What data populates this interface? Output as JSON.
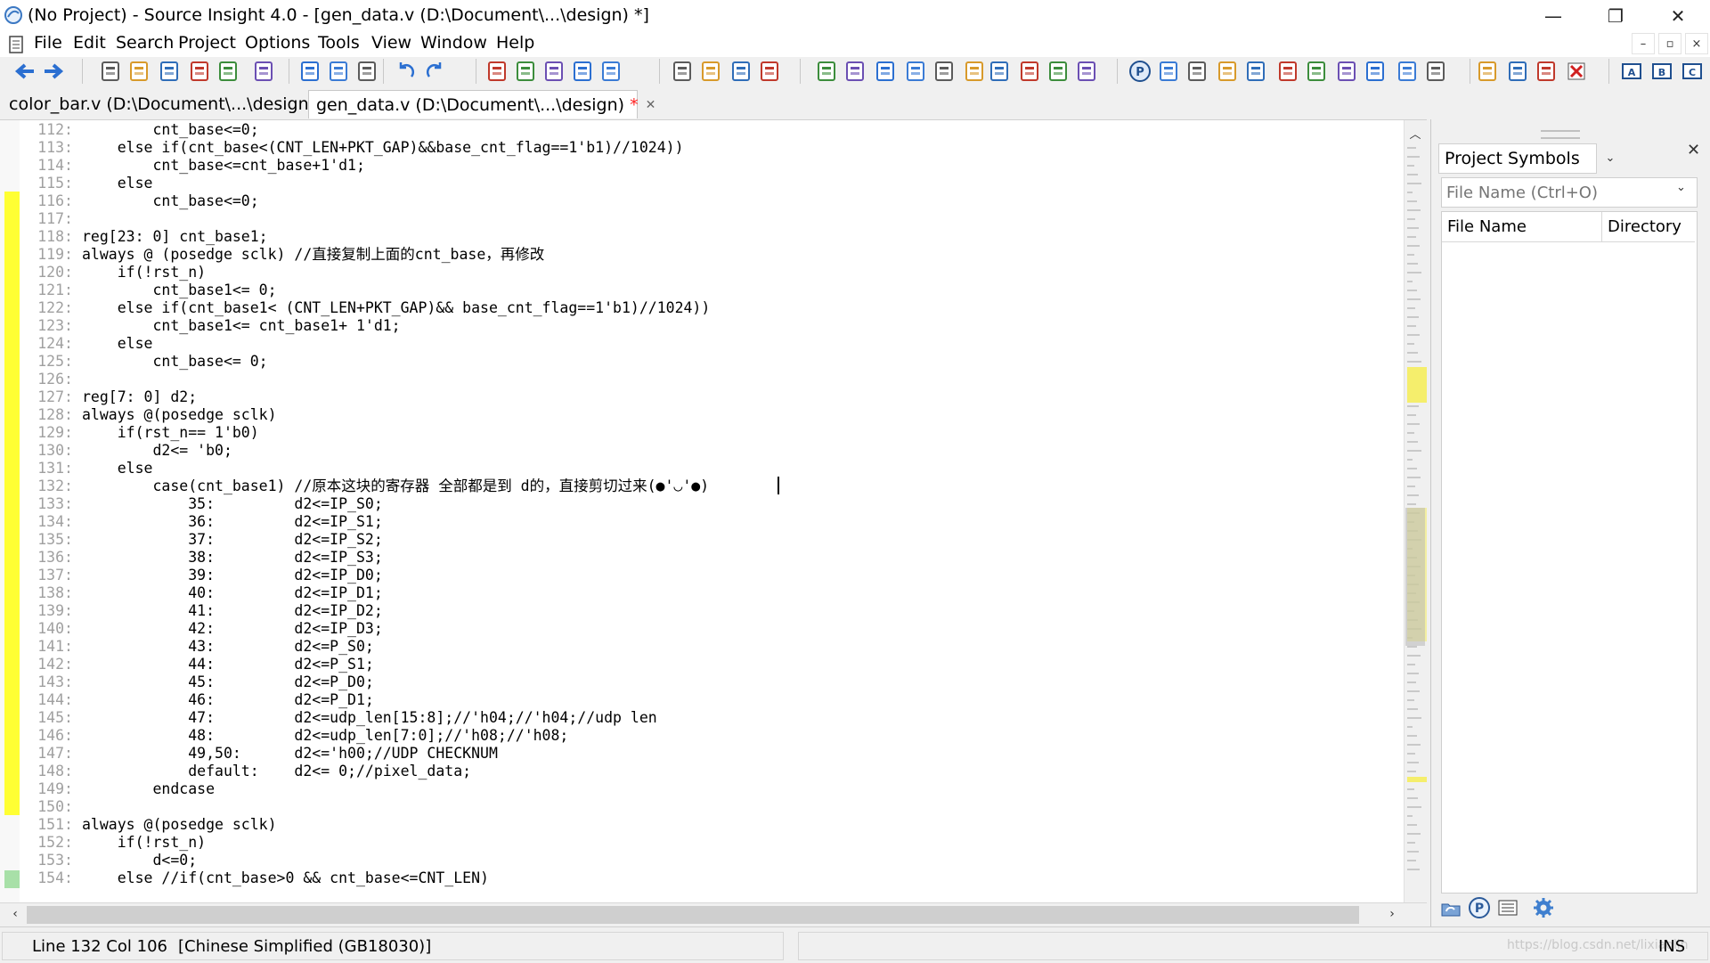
{
  "window": {
    "title": "(No Project) - Source Insight 4.0 - [gen_data.v (D:\\Document\\...\\design) *]",
    "minimize_glyph": "—",
    "restore_glyph": "❐",
    "close_glyph": "✕"
  },
  "menu": {
    "items": [
      "File",
      "Edit",
      "Search",
      "Project",
      "Options",
      "Tools",
      "View",
      "Window",
      "Help"
    ],
    "mdi_minimize": "–",
    "mdi_restore": "▫",
    "mdi_close": "×"
  },
  "toolbar": {
    "icons": [
      "back-icon",
      "forward-icon",
      "new-file-icon",
      "open-file-icon",
      "save-icon",
      "save-as-icon",
      "save-all-icon",
      "print-icon",
      "cut-icon",
      "copy-icon",
      "paste-icon",
      "undo-icon",
      "redo-icon",
      "find-icon",
      "jump-up-icon",
      "jump-down-icon",
      "replace-icon",
      "swap-xy-icon",
      "bookmark-prev-icon",
      "bookmark-next-icon",
      "indent-icon",
      "star-icon",
      "browse-icon",
      "symbol-window-icon",
      "book-icon",
      "function-icon",
      "relation-icon",
      "script-r-icon",
      "grid-icon",
      "horizontal-split-icon",
      "list-icon",
      "windows-icon",
      "project-icon",
      "resize-icon",
      "outline-icon",
      "sync-icon",
      "branch-icon",
      "help-icon",
      "tree-icon",
      "globe-icon",
      "bird-icon",
      "merge-icon",
      "compare-icon",
      "plus-minus-icon",
      "add-row-icon",
      "remove-row-icon",
      "delete-icon",
      "toggle-a-icon",
      "toggle-b-icon",
      "toggle-c-icon"
    ]
  },
  "tabs": [
    {
      "label": "color_bar.v (D:\\Document\\...\\design)",
      "modified": ""
    },
    {
      "label": "gen_data.v (D:\\Document\\...\\design)",
      "modified": "*",
      "close": "✕"
    }
  ],
  "editor": {
    "lines": [
      {
        "n": "112:",
        "t": "        cnt_base<=0;"
      },
      {
        "n": "113:",
        "t": "    else if(cnt_base<(CNT_LEN+PKT_GAP)&&base_cnt_flag==1'b1)//1024))"
      },
      {
        "n": "114:",
        "t": "        cnt_base<=cnt_base+1'd1;"
      },
      {
        "n": "115:",
        "t": "    else"
      },
      {
        "n": "116:",
        "t": "        cnt_base<=0;"
      },
      {
        "n": "117:",
        "t": ""
      },
      {
        "n": "118:",
        "t": "reg[23: 0] cnt_base1;"
      },
      {
        "n": "119:",
        "t": "always @ (posedge sclk) //直接复制上面的cnt_base，再修改"
      },
      {
        "n": "120:",
        "t": "    if(!rst_n)"
      },
      {
        "n": "121:",
        "t": "        cnt_base1<= 0;"
      },
      {
        "n": "122:",
        "t": "    else if(cnt_base1< (CNT_LEN+PKT_GAP)&& base_cnt_flag==1'b1)//1024))"
      },
      {
        "n": "123:",
        "t": "        cnt_base1<= cnt_base1+ 1'd1;"
      },
      {
        "n": "124:",
        "t": "    else"
      },
      {
        "n": "125:",
        "t": "        cnt_base<= 0;"
      },
      {
        "n": "126:",
        "t": ""
      },
      {
        "n": "127:",
        "t": "reg[7: 0] d2;"
      },
      {
        "n": "128:",
        "t": "always @(posedge sclk)"
      },
      {
        "n": "129:",
        "t": "    if(rst_n== 1'b0)"
      },
      {
        "n": "130:",
        "t": "        d2<= 'b0;"
      },
      {
        "n": "131:",
        "t": "    else"
      },
      {
        "n": "132:",
        "t": "        case(cnt_base1) //原本这块的寄存器 全部都是到 d的，直接剪切过来(●'◡'●)"
      },
      {
        "n": "133:",
        "t": "            35:         d2<=IP_S0;"
      },
      {
        "n": "134:",
        "t": "            36:         d2<=IP_S1;"
      },
      {
        "n": "135:",
        "t": "            37:         d2<=IP_S2;"
      },
      {
        "n": "136:",
        "t": "            38:         d2<=IP_S3;"
      },
      {
        "n": "137:",
        "t": "            39:         d2<=IP_D0;"
      },
      {
        "n": "138:",
        "t": "            40:         d2<=IP_D1;"
      },
      {
        "n": "139:",
        "t": "            41:         d2<=IP_D2;"
      },
      {
        "n": "140:",
        "t": "            42:         d2<=IP_D3;"
      },
      {
        "n": "141:",
        "t": "            43:         d2<=P_S0;"
      },
      {
        "n": "142:",
        "t": "            44:         d2<=P_S1;"
      },
      {
        "n": "143:",
        "t": "            45:         d2<=P_D0;"
      },
      {
        "n": "144:",
        "t": "            46:         d2<=P_D1;"
      },
      {
        "n": "145:",
        "t": "            47:         d2<=udp_len[15:8];//'h04;//'h04;//udp len"
      },
      {
        "n": "146:",
        "t": "            48:         d2<=udp_len[7:0];//'h08;//'h08;"
      },
      {
        "n": "147:",
        "t": "            49,50:      d2<='h00;//UDP CHECKNUM"
      },
      {
        "n": "148:",
        "t": "            default:    d2<= 0;//pixel_data;"
      },
      {
        "n": "149:",
        "t": "        endcase"
      },
      {
        "n": "150:",
        "t": ""
      },
      {
        "n": "151:",
        "t": "always @(posedge sclk)"
      },
      {
        "n": "152:",
        "t": "    if(!rst_n)"
      },
      {
        "n": "153:",
        "t": "        d<=0;"
      },
      {
        "n": "154:",
        "t": "    else //if(cnt_base>0 && cnt_base<=CNT_LEN)"
      }
    ],
    "scroll_up": "︿",
    "scroll_down": "﹀",
    "scroll_left": "‹",
    "scroll_right": "›"
  },
  "panel": {
    "title": "Project Symbols",
    "dropdown_glyph": "⌄",
    "close_glyph": "✕",
    "filter_placeholder": "File Name (Ctrl+O)",
    "columns": [
      "File Name",
      "Directory"
    ],
    "bottom_icons": [
      "folder-sync-icon",
      "project-p-icon",
      "list-view-icon",
      "gear-icon"
    ]
  },
  "status": {
    "position": "Line 132  Col 106",
    "encoding": "[Chinese Simplified (GB18030)]",
    "mode": "INS",
    "watermark": "https://blog.csdn.net/lixiaolin"
  },
  "colors": {
    "change_bar": "#ffff33",
    "change_bar_saved": "#a8e0a8",
    "accent_icon": "#2b6fd1",
    "modified": "#ff2020"
  }
}
